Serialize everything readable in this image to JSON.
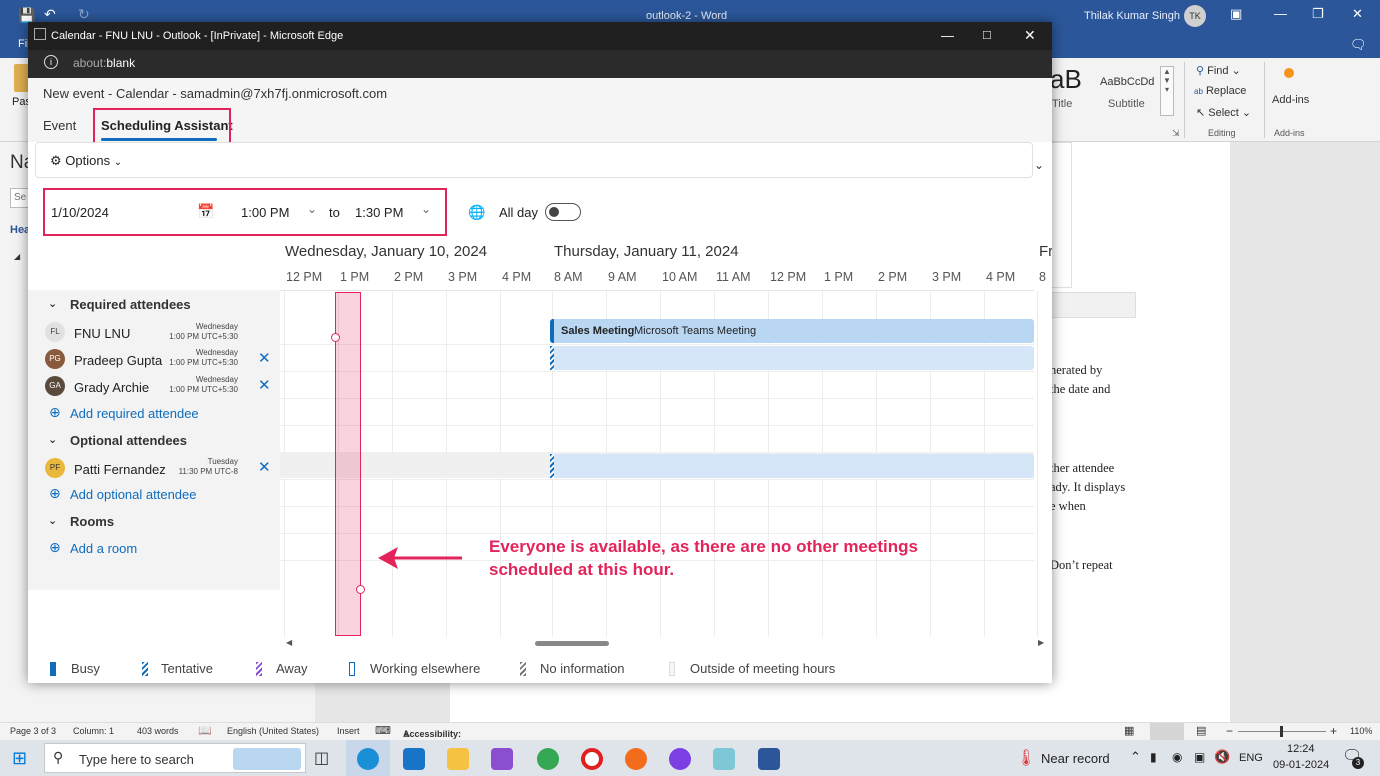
{
  "word": {
    "title": "outlook-2 - Word",
    "user": "Thilak Kumar Singh",
    "user_initials": "TK",
    "file_tab_partial": "Fil",
    "paste_partial": "Pas",
    "nav_partial": "Na",
    "search_partial": "Se",
    "headings_partial": "Hea",
    "styles": {
      "style1": "aB",
      "style1_name": "Title",
      "style2": "AaBbCcDd",
      "style2_name": "Subtitle"
    },
    "editing": {
      "find": "Find",
      "replace": "Replace",
      "select": "Select",
      "group": "Editing"
    },
    "addins": {
      "label": "Add-ins",
      "group": "Add-ins"
    },
    "doc_lines": [
      "nerated by",
      "the date and",
      "ther attendee",
      "ady. It displays",
      "e when",
      "Don’t repeat"
    ],
    "status": {
      "page": "Page 3 of 3",
      "column": "Column: 1",
      "words": "403 words",
      "language": "English (United States)",
      "mode": "Insert",
      "accessibility": "Accessibility: Investigate",
      "zoom": "110%"
    }
  },
  "taskbar": {
    "search": "Type here to search",
    "weather": "Near record",
    "lang": "ENG",
    "time": "12:24",
    "date": "09-01-2024",
    "notif": "3"
  },
  "edge": {
    "title": "Calendar - FNU LNU - Outlook - [InPrivate] - Microsoft Edge",
    "address": "about:blank",
    "address_prefix": "about:",
    "address_rest": "blank"
  },
  "event": {
    "header": "New event - Calendar - samadmin@7xh7fj.onmicrosoft.com",
    "tabs": {
      "event": "Event",
      "scheduling": "Scheduling Assistant"
    },
    "options": "Options",
    "date": "1/10/2024",
    "start_time": "1:00 PM",
    "to": "to",
    "end_time": "1:30 PM",
    "all_day": "All day",
    "all_day_on": false
  },
  "timeline": {
    "day1": "Wednesday, January 10, 2024",
    "day2": "Thursday, January 11, 2024",
    "day3": "Fr",
    "hours": [
      "12 PM",
      "1 PM",
      "2 PM",
      "3 PM",
      "4 PM",
      "8 AM",
      "9 AM",
      "10 AM",
      "11 AM",
      "12 PM",
      "1 PM",
      "2 PM",
      "3 PM",
      "4 PM",
      "8"
    ]
  },
  "attendees": {
    "required_header": "Required attendees",
    "optional_header": "Optional attendees",
    "rooms_header": "Rooms",
    "add_required": "Add required attendee",
    "add_optional": "Add optional attendee",
    "add_room": "Add a room",
    "required": [
      {
        "name": "FNU LNU",
        "initials": "FL",
        "day": "Wednesday",
        "time": "1:00 PM UTC+5:30"
      },
      {
        "name": "Pradeep Gupta",
        "initials": "PG",
        "day": "Wednesday",
        "time": "1:00 PM UTC+5:30"
      },
      {
        "name": "Grady Archie",
        "initials": "GA",
        "day": "Wednesday",
        "time": "1:00 PM UTC+5:30"
      }
    ],
    "optional": [
      {
        "name": "Patti Fernandez",
        "initials": "PF",
        "day": "Tuesday",
        "time": "11:30 PM UTC-8"
      }
    ]
  },
  "meeting": {
    "title": "Sales Meeting",
    "subtitle": "Microsoft Teams Meeting"
  },
  "legend": {
    "busy": "Busy",
    "tentative": "Tentative",
    "away": "Away",
    "elsewhere": "Working elsewhere",
    "noinfo": "No information",
    "outside": "Outside of meeting hours"
  },
  "annotation": {
    "line1": "Everyone is available, as there are no other meetings",
    "line2": "scheduled at this hour."
  },
  "colors": {
    "accent": "#0f6cbd",
    "highlight": "#e3245b",
    "busy": "#0f6cbd",
    "free_block": "#cfe4f7"
  }
}
